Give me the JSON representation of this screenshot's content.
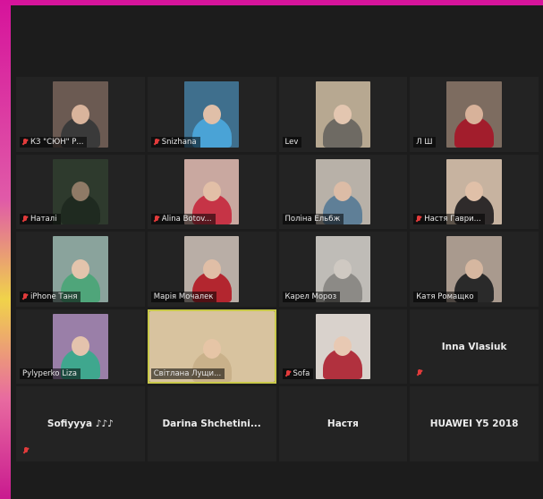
{
  "participants": [
    {
      "name": "КЗ \"СЮН\" Р...",
      "muted": true,
      "video": true,
      "bg": "#6b5a52",
      "shirt": "#3a3a3a",
      "skin": "#d9b49c"
    },
    {
      "name": "Snizhana",
      "muted": true,
      "video": true,
      "bg": "#3f6f8d",
      "shirt": "#4aa3d6",
      "skin": "#e0bfa8"
    },
    {
      "name": "Lev",
      "muted": false,
      "video": true,
      "bg": "#b7a891",
      "shirt": "#6e6a63",
      "skin": "#e3c6b0"
    },
    {
      "name": "Л Ш",
      "muted": false,
      "video": true,
      "bg": "#7d6c60",
      "shirt": "#a21d2c",
      "skin": "#d8b29a"
    },
    {
      "name": "Наталі",
      "muted": true,
      "video": true,
      "bg": "#2e3a2d",
      "shirt": "#1f2a20",
      "skin": "#8f7a66"
    },
    {
      "name": "Alina Botov...",
      "muted": true,
      "video": true,
      "bg": "#c9a8a0",
      "shirt": "#c63446",
      "skin": "#e2bfa7"
    },
    {
      "name": "Поліна Ель6ж",
      "muted": false,
      "video": true,
      "bg": "#b8b1a8",
      "shirt": "#5f7f97",
      "skin": "#dcbca6"
    },
    {
      "name": "Настя Гаври...",
      "muted": true,
      "video": true,
      "bg": "#c7b3a0",
      "shirt": "#2f2b2b",
      "skin": "#e0c0a8"
    },
    {
      "name": "iPhone Таня",
      "muted": true,
      "video": true,
      "bg": "#8aa39c",
      "shirt": "#4fa57a",
      "skin": "#e3c4ac"
    },
    {
      "name": "Марія Мочалек",
      "muted": false,
      "video": true,
      "bg": "#b9aea6",
      "shirt": "#b3262f",
      "skin": "#e0bea6"
    },
    {
      "name": "Карел Мороз",
      "muted": false,
      "video": true,
      "bg": "#bfbcb7",
      "shirt": "#8c8a86",
      "skin": "#cfc9c2"
    },
    {
      "name": "Катя Ромащко",
      "muted": false,
      "video": true,
      "bg": "#a99a8e",
      "shirt": "#2a2a2a",
      "skin": "#d6b7a0"
    },
    {
      "name": "Pylyperko Liza",
      "muted": false,
      "video": true,
      "bg": "#9a7fa8",
      "shirt": "#3fa78e",
      "skin": "#e4c3ad"
    },
    {
      "name": "Світлана Лущи...",
      "muted": false,
      "video": true,
      "bg": "#d8c39f",
      "shirt": "#c9b18a",
      "skin": "#e6c5a6",
      "active": true
    },
    {
      "name": "Sofa",
      "muted": true,
      "video": true,
      "bg": "#d9d2cc",
      "shirt": "#b1313e",
      "skin": "#e8c9b3"
    },
    {
      "name": "Inna Vlasiuk",
      "muted": true,
      "video": false
    },
    {
      "name": "Sofiyyya ♪♪♪",
      "muted": true,
      "video": false
    },
    {
      "name": "Darina  Shchetini...",
      "muted": false,
      "video": false
    },
    {
      "name": "Настя",
      "muted": false,
      "video": false
    },
    {
      "name": "HUAWEI Y5 2018",
      "muted": false,
      "video": false
    }
  ]
}
